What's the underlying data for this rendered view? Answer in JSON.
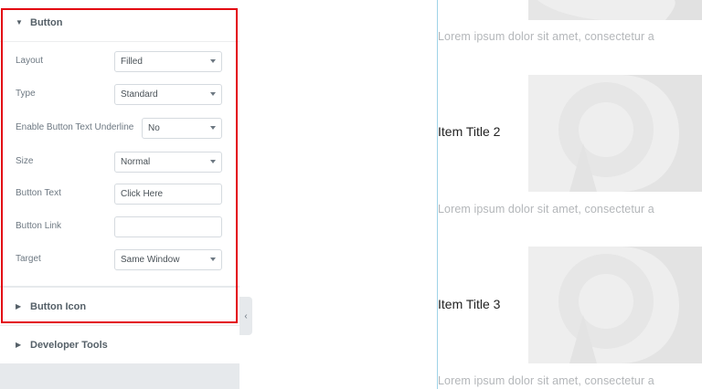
{
  "panel": {
    "button_section": {
      "title": "Button",
      "controls": [
        {
          "label": "Layout",
          "value": "Filled",
          "kind": "select"
        },
        {
          "label": "Type",
          "value": "Standard",
          "kind": "select"
        },
        {
          "label": "Enable Button Text Underline",
          "value": "No",
          "kind": "select"
        },
        {
          "label": "Size",
          "value": "Normal",
          "kind": "select"
        },
        {
          "label": "Button Text",
          "value": "Click Here",
          "kind": "text"
        },
        {
          "label": "Button Link",
          "value": "",
          "kind": "text"
        },
        {
          "label": "Target",
          "value": "Same Window",
          "kind": "select"
        }
      ]
    },
    "button_icon_section": {
      "title": "Button Icon"
    },
    "developer_tools_section": {
      "title": "Developer Tools"
    },
    "highlight_color": "#e3000f"
  },
  "preview": {
    "items": [
      {
        "description": "Lorem ipsum dolor sit amet, consectetur a"
      },
      {
        "title": "Item Title 2",
        "description": "Lorem ipsum dolor sit amet, consectetur a"
      },
      {
        "title": "Item Title 3",
        "description": "Lorem ipsum dolor sit amet, consectetur a"
      }
    ]
  },
  "icons": {
    "expanded_caret": "caret-down-icon",
    "collapsed_caret": "caret-right-icon",
    "dropdown": "chevron-down-icon",
    "collapse_handle": "chevron-left-icon",
    "placeholder_image": "image-placeholder-icon"
  }
}
